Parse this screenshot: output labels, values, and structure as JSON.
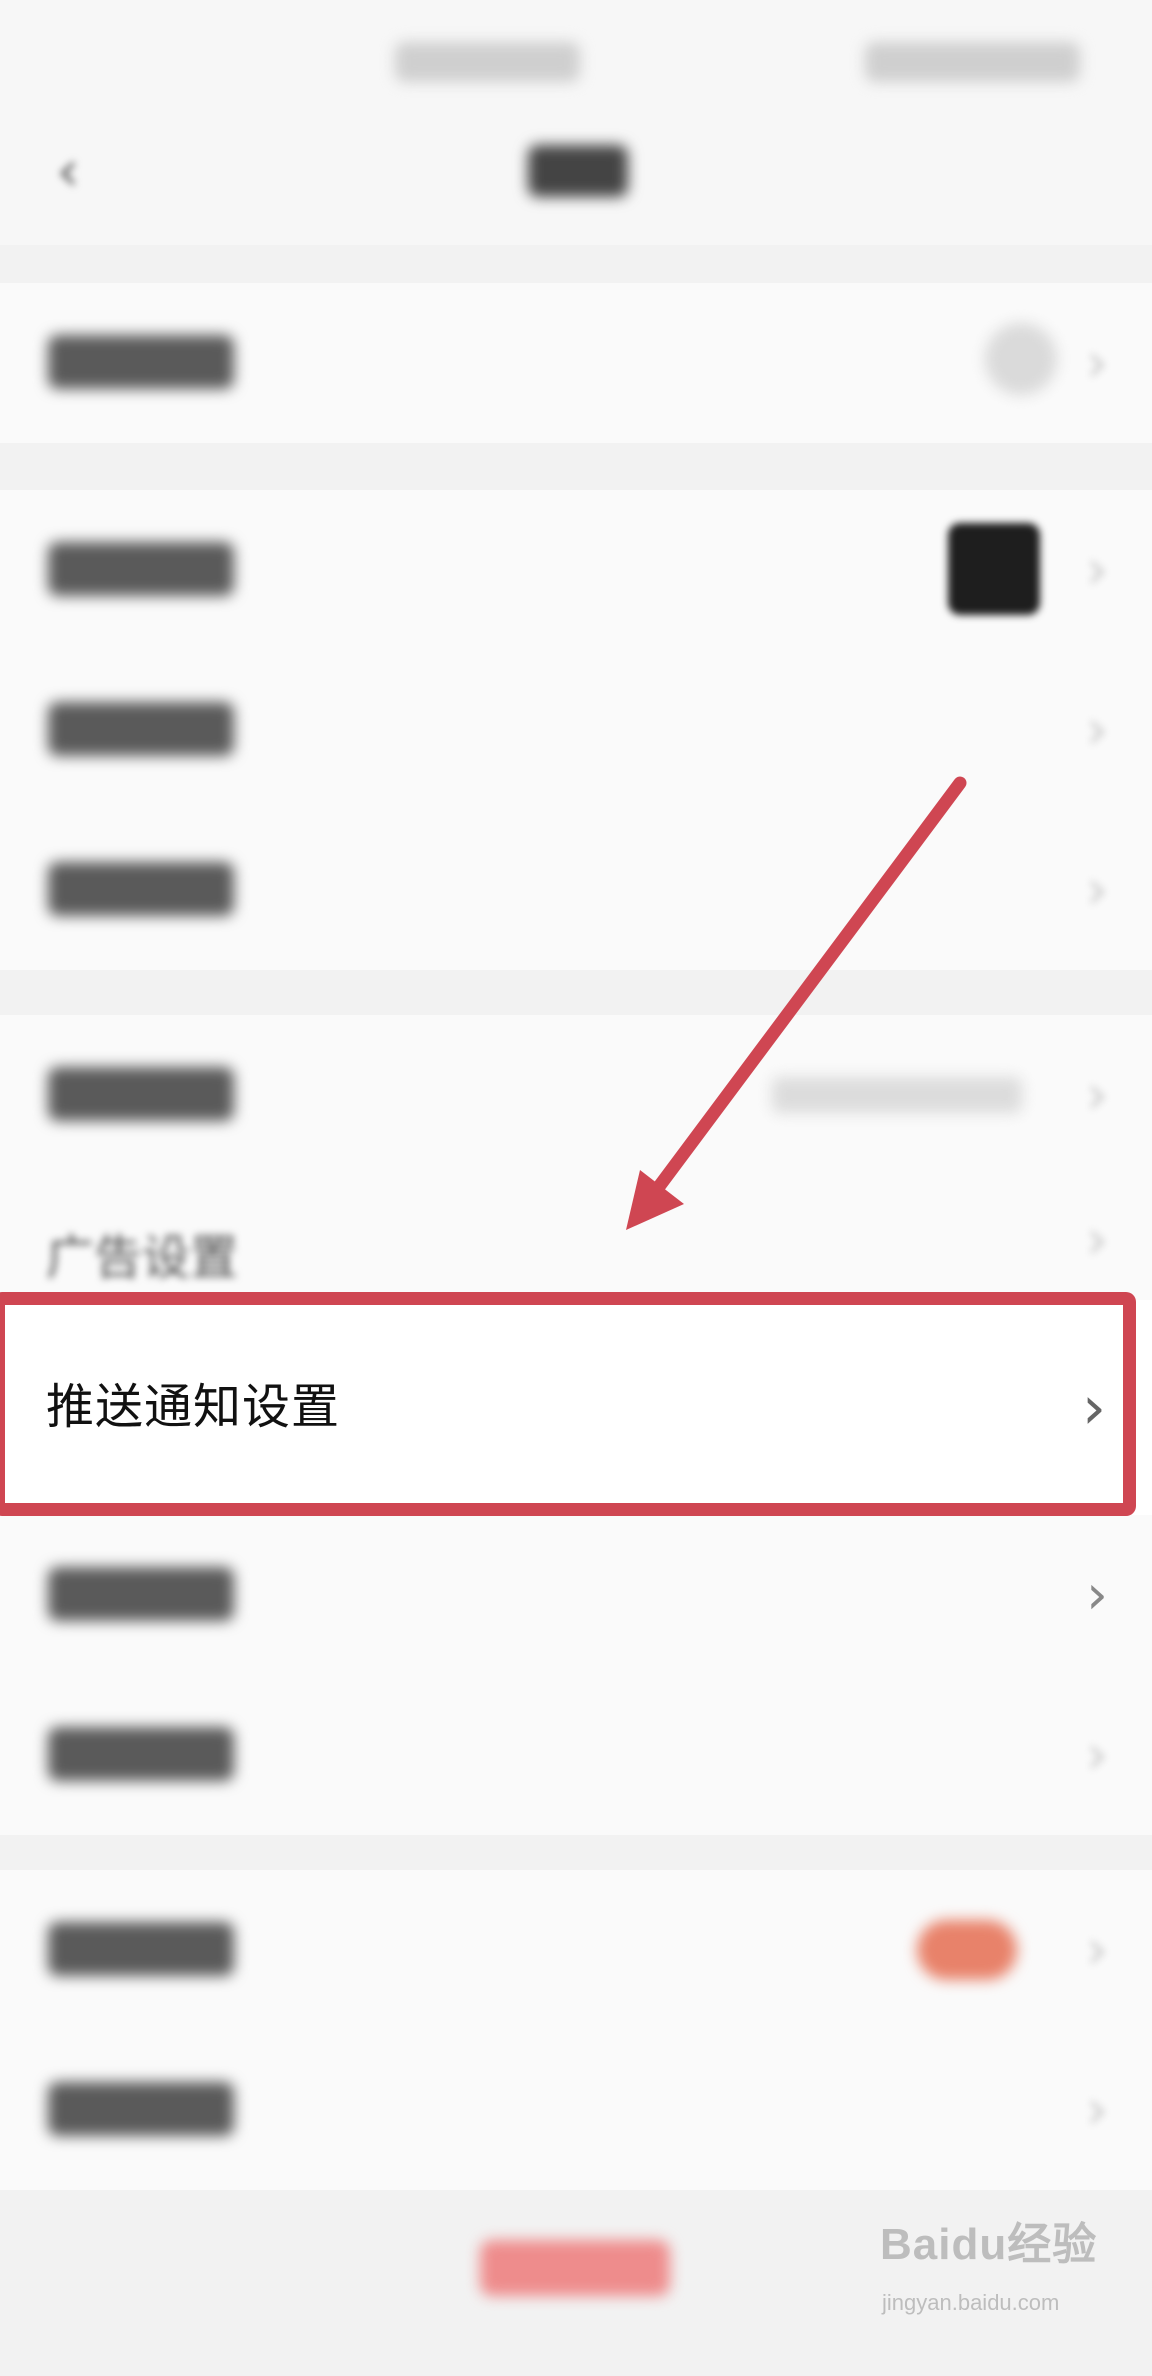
{
  "highlighted_row": {
    "label": "推送通知设置",
    "chevron": "›"
  },
  "partial_row": {
    "label": "广告设置"
  },
  "navigation": {
    "back_glyph": "‹"
  },
  "rows_chevron": "›",
  "watermark": {
    "brand": "Baidu经验",
    "url": "jingyan.baidu.com"
  },
  "colors": {
    "highlight": "#cf4652",
    "badge": "#e8826a",
    "logout": "#ee8c8c"
  },
  "icons": {
    "back": "chevron-left-icon",
    "row": "chevron-right-icon",
    "annotation": "arrow-icon"
  }
}
